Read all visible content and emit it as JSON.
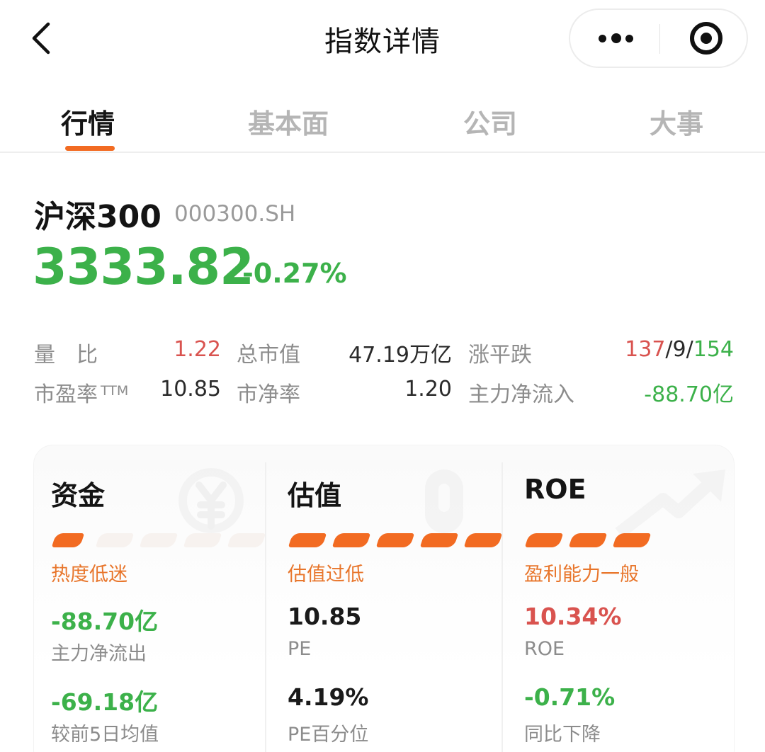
{
  "nav": {
    "title": "指数详情"
  },
  "tabs": [
    {
      "label": "行情",
      "active": true
    },
    {
      "label": "基本面",
      "active": false
    },
    {
      "label": "公司",
      "active": false
    },
    {
      "label": "大事",
      "active": false
    }
  ],
  "index": {
    "name": "沪深300",
    "code": "000300.SH",
    "price": "3333.82",
    "change": "-0.27%"
  },
  "stats": {
    "volume_ratio": {
      "label": "量　比",
      "value": "1.22"
    },
    "market_cap": {
      "label": "总市值",
      "value": "47.19万亿"
    },
    "advance_decline": {
      "label": "涨平跌",
      "up": "137",
      "sep1": "/",
      "flat": "9",
      "sep2": "/",
      "down": "154"
    },
    "pe_ttm": {
      "label": "市盈率",
      "suffix": "TTM",
      "value": "10.85"
    },
    "pb": {
      "label": "市净率",
      "value": "1.20"
    },
    "main_flow": {
      "label": "主力净流入",
      "value": "-88.70亿"
    }
  },
  "metrics": {
    "funds": {
      "title": "资金",
      "icon": "yen-refresh-icon",
      "level": 1,
      "segments": 5,
      "status": "热度低迷",
      "value1": "-88.70亿",
      "label1": "主力净流出",
      "value2": "-69.18亿",
      "label2": "较前5日均值"
    },
    "valuation": {
      "title": "估值",
      "icon": "thermometer-icon",
      "level": 5,
      "segments": 5,
      "status": "估值过低",
      "value1": "10.85",
      "label1": "PE",
      "value2": "4.19%",
      "label2": "PE百分位"
    },
    "roe": {
      "title": "ROE",
      "icon": "trend-up-arrow-icon",
      "level": 3,
      "segments": 3,
      "status": "盈利能力一般",
      "value1": "10.34%",
      "label1": "ROE",
      "value2": "-0.71%",
      "label2": "同比下降"
    }
  },
  "colors": {
    "accent": "#f26b22",
    "up": "#d9534f",
    "down": "#3cb14a",
    "status": "#e8762c"
  }
}
